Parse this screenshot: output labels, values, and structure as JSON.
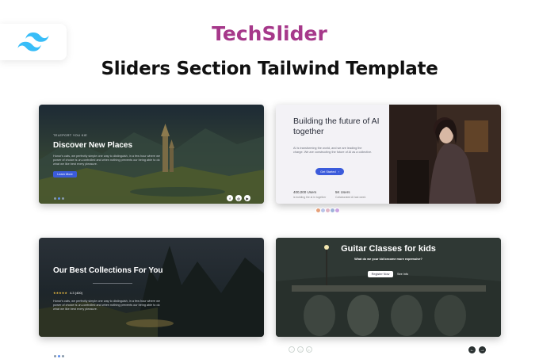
{
  "header": {
    "logo_icon": "tailwind-logo-icon",
    "brand_main": "TechSlider",
    "subtitle": "Sliders Section Tailwind Template"
  },
  "colors": {
    "brand": "#a6388a",
    "tailwind_blue": "#38bdf8",
    "button_blue": "#3b5bdb"
  },
  "cards": {
    "discover": {
      "eyebrow": "TELEPORT YOU KIE",
      "title": "Discover New Places",
      "paragraph": "Honor's cats, we perfectly simple one way to distinguish, in a few hour where we power of choice is un-controlled and when nothing prevents our being able to do what we like best every pleasure.",
      "button": "Learn More",
      "social": [
        "f",
        "◎",
        "▶"
      ]
    },
    "ai": {
      "title": "Building the future of AI together",
      "paragraph": "AI is transforming the world, and we are leading the charge. We are constructing the future of AI as a collective.",
      "button": "Get Started",
      "stat1_num": "400,000 Users",
      "stat1_label": "is building the ai in together",
      "stat2_num": "5K Users",
      "stat2_label": "Collaborated AI last week"
    },
    "collections": {
      "title": "Our Best Collections For You",
      "rating": "4.3 (400)",
      "stars": "★★★★★",
      "paragraph": "Honor's cats, we perfectly simple one way to distinguish, in a few hour where we power of choice is un-controlled and when nothing prevents our being able to do what we like best every pleasure."
    },
    "guitar": {
      "title": "Guitar Classes for kids",
      "question": "What do we your kid become more expressive?",
      "register_button": "Register Now",
      "link": "See Info",
      "social": [
        "f",
        "◎",
        "▶"
      ]
    }
  }
}
